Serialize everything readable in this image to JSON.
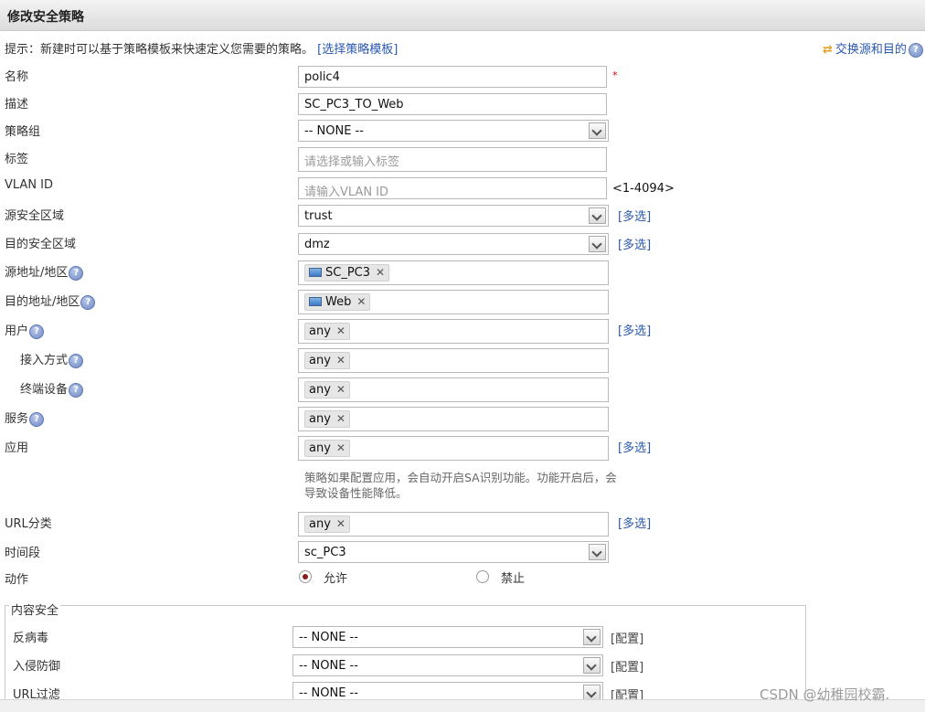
{
  "title": "修改安全策略",
  "hint": {
    "text": "提示：新建时可以基于策略模板来快速定义您需要的策略。",
    "template_link": "[选择策略模板]"
  },
  "swap_link": "交换源和目的",
  "help_glyph": "?",
  "required_mark": "*",
  "fields": {
    "name": {
      "label": "名称",
      "value": "polic4"
    },
    "description": {
      "label": "描述",
      "value": "SC_PC3_TO_Web"
    },
    "policy_group": {
      "label": "策略组",
      "value": "-- NONE --"
    },
    "tag": {
      "label": "标签",
      "placeholder": "请选择或输入标签"
    },
    "vlan": {
      "label": "VLAN ID",
      "placeholder": "请输入VLAN ID",
      "range": "<1-4094>"
    },
    "src_zone": {
      "label": "源安全区域",
      "value": "trust",
      "multi": "[多选]"
    },
    "dst_zone": {
      "label": "目的安全区域",
      "value": "dmz",
      "multi": "[多选]"
    },
    "src_addr": {
      "label": "源地址/地区",
      "tag": "SC_PC3"
    },
    "dst_addr": {
      "label": "目的地址/地区",
      "tag": "Web"
    },
    "user": {
      "label": "用户",
      "tag": "any",
      "multi": "[多选]"
    },
    "access_mode": {
      "label": "接入方式",
      "tag": "any"
    },
    "terminal": {
      "label": "终端设备",
      "tag": "any"
    },
    "service": {
      "label": "服务",
      "tag": "any"
    },
    "application": {
      "label": "应用",
      "tag": "any",
      "multi": "[多选]",
      "note": "策略如果配置应用，会自动开启SA识别功能。功能开启后，会导致设备性能降低。"
    },
    "url_category": {
      "label": "URL分类",
      "tag": "any",
      "multi": "[多选]"
    },
    "time_range": {
      "label": "时间段",
      "value": "sc_PC3"
    },
    "action": {
      "label": "动作",
      "allow": "允许",
      "deny": "禁止",
      "selected": "allow"
    }
  },
  "tag_remove": "✕",
  "content_security": {
    "legend": "内容安全",
    "rows": [
      {
        "label": "反病毒",
        "value": "-- NONE --",
        "config": "[配置]"
      },
      {
        "label": "入侵防御",
        "value": "-- NONE --",
        "config": "[配置]"
      },
      {
        "label": "URL过滤",
        "value": "-- NONE --",
        "config": "[配置]"
      }
    ]
  },
  "watermark": "CSDN @幼稚园校霸."
}
